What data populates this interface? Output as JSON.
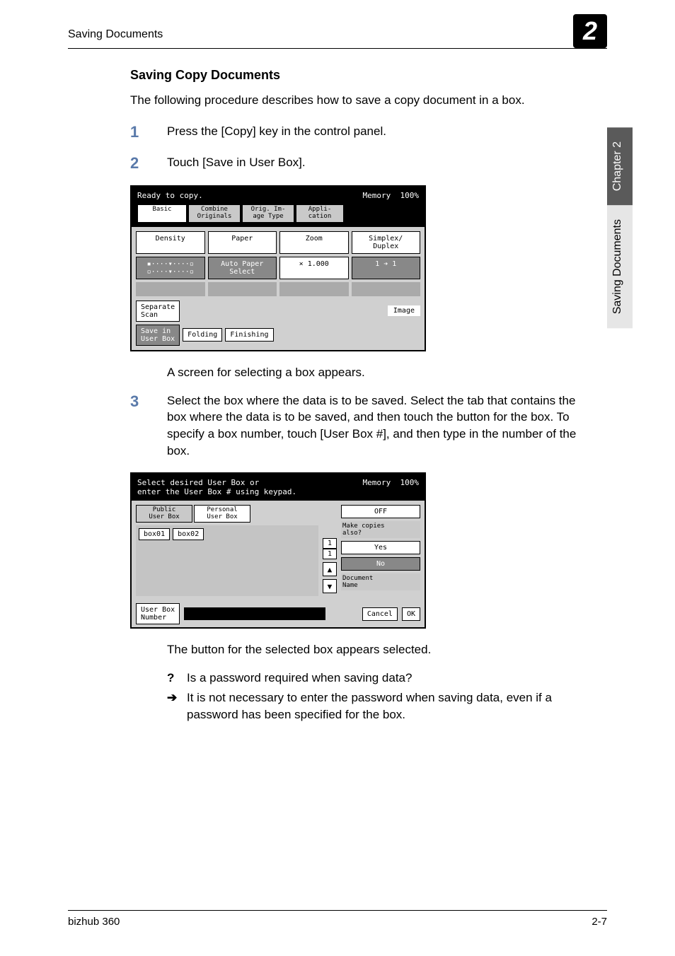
{
  "header": {
    "left": "Saving Documents",
    "num": "2"
  },
  "side": {
    "chapter": "Chapter 2",
    "title": "Saving Documents"
  },
  "heading": "Saving Copy Documents",
  "intro": "The following procedure describes how to save a copy document in a box.",
  "steps": {
    "1": {
      "num": "1",
      "text": "Press the [Copy] key in the control panel."
    },
    "2": {
      "num": "2",
      "text": "Touch [Save in User Box]."
    },
    "3": {
      "num": "3",
      "text": "Select the box where the data is to be saved. Select the tab that contains the box where the data is to be saved, and then touch the button for the box. To specify a box number, touch [User Box #], and then type in the number of the box."
    }
  },
  "after2": "A screen for selecting a box appears.",
  "after3": "The button for the selected box appears selected.",
  "qa": {
    "q": "Is a password required when saving data?",
    "a": "It is not necessary to enter the password when saving data, even if a password has been specified for the box."
  },
  "scr1": {
    "status": "Ready to copy.",
    "memory": "Memory",
    "memval": "100%",
    "tabs": {
      "basic": "Basic",
      "combine": "Combine\nOriginals",
      "orig": "Orig. Im-\nage Type",
      "appli": "Appli-\ncation"
    },
    "cols": {
      "density": "Density",
      "paper": "Paper",
      "zoom": "Zoom",
      "simplex": "Simplex/\nDuplex"
    },
    "autopaper": "Auto Paper\nSelect",
    "zoomval": "× 1.000",
    "duplex": "1 ➔ 1",
    "separate": "Separate\nScan",
    "saveinbox": "Save in\nUser Box",
    "folding": "Folding",
    "finishing": "Finishing",
    "image": "Image"
  },
  "scr2": {
    "status1": "Select desired User Box or",
    "status2": "enter the User Box # using keypad.",
    "memory": "Memory",
    "memval": "100%",
    "tabpublic": "Public\nUser Box",
    "tabpersonal": "Personal\nUser Box",
    "off": "OFF",
    "box1": "box01",
    "box2": "box02",
    "page1": "1",
    "page2": "1",
    "makecopies": "Make copies\nalso?",
    "yes": "Yes",
    "no": "No",
    "docname": "Document\nName",
    "userboxnum": "User Box\nNumber",
    "cancel": "Cancel",
    "ok": "OK"
  },
  "footer": {
    "left": "bizhub 360",
    "right": "2-7"
  }
}
